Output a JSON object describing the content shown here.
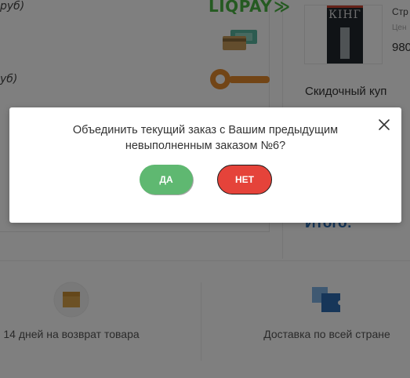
{
  "payment": {
    "method1_label": "руб)",
    "method2_label": "уб)",
    "liqpay_logo": "LIQPAY",
    "icons": [
      "cash-icon",
      "key-icon"
    ]
  },
  "product": {
    "cover_author": "КІНГ",
    "name": "Стр",
    "old_price": "Цен",
    "price": "980"
  },
  "coupon": {
    "title": "Скидочный куп"
  },
  "total": {
    "label": "Итого:"
  },
  "features": [
    {
      "icon": "box-icon",
      "label": "14 дней на возврат товара"
    },
    {
      "icon": "delivery-icon",
      "label": "Доставка по всей стране"
    }
  ],
  "modal": {
    "message": "Объединить текущий заказ с Вашим предыдущим невыполненным заказом №6?",
    "yes_label": "ДА",
    "no_label": "НЕТ",
    "close_icon": "close-icon"
  },
  "colors": {
    "yes_button": "#5fb871",
    "no_button": "#e5433a",
    "liqpay_green": "#4bb543",
    "total_blue": "#2d6fb7"
  }
}
